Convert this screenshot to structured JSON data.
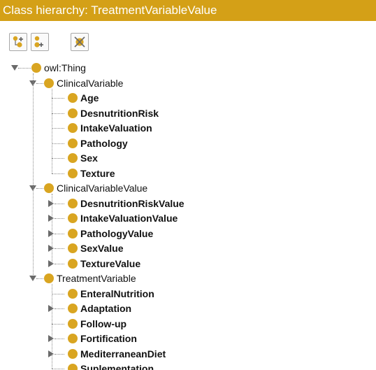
{
  "panel": {
    "title": "Class hierarchy: TreatmentVariableValue",
    "toolbar": {
      "add_subclass_icon": "add-subclass-icon",
      "add_sibling_icon": "add-sibling-icon",
      "delete_class_icon": "delete-class-icon"
    }
  },
  "tree": {
    "root": "owl:Thing",
    "groups": [
      {
        "label": "ClinicalVariable",
        "children": [
          {
            "label": "Age",
            "expandable": false
          },
          {
            "label": "DesnutritionRisk",
            "expandable": false
          },
          {
            "label": "IntakeValuation",
            "expandable": false
          },
          {
            "label": "Pathology",
            "expandable": false
          },
          {
            "label": "Sex",
            "expandable": false
          },
          {
            "label": "Texture",
            "expandable": false
          }
        ]
      },
      {
        "label": "ClinicalVariableValue",
        "children": [
          {
            "label": "DesnutritionRiskValue",
            "expandable": true
          },
          {
            "label": "IntakeValuationValue",
            "expandable": true
          },
          {
            "label": "PathologyValue",
            "expandable": true
          },
          {
            "label": "SexValue",
            "expandable": true
          },
          {
            "label": "TextureValue",
            "expandable": true
          }
        ]
      },
      {
        "label": "TreatmentVariable",
        "children": [
          {
            "label": "EnteralNutrition",
            "expandable": false
          },
          {
            "label": "Adaptation",
            "expandable": true
          },
          {
            "label": "Follow-up",
            "expandable": false
          },
          {
            "label": "Fortification",
            "expandable": true
          },
          {
            "label": "MediterraneanDiet",
            "expandable": true
          },
          {
            "label": "Suplementation",
            "expandable": false
          }
        ]
      }
    ]
  },
  "colors": {
    "title_bar": "#d4a017",
    "class_node": "#d9a521"
  }
}
